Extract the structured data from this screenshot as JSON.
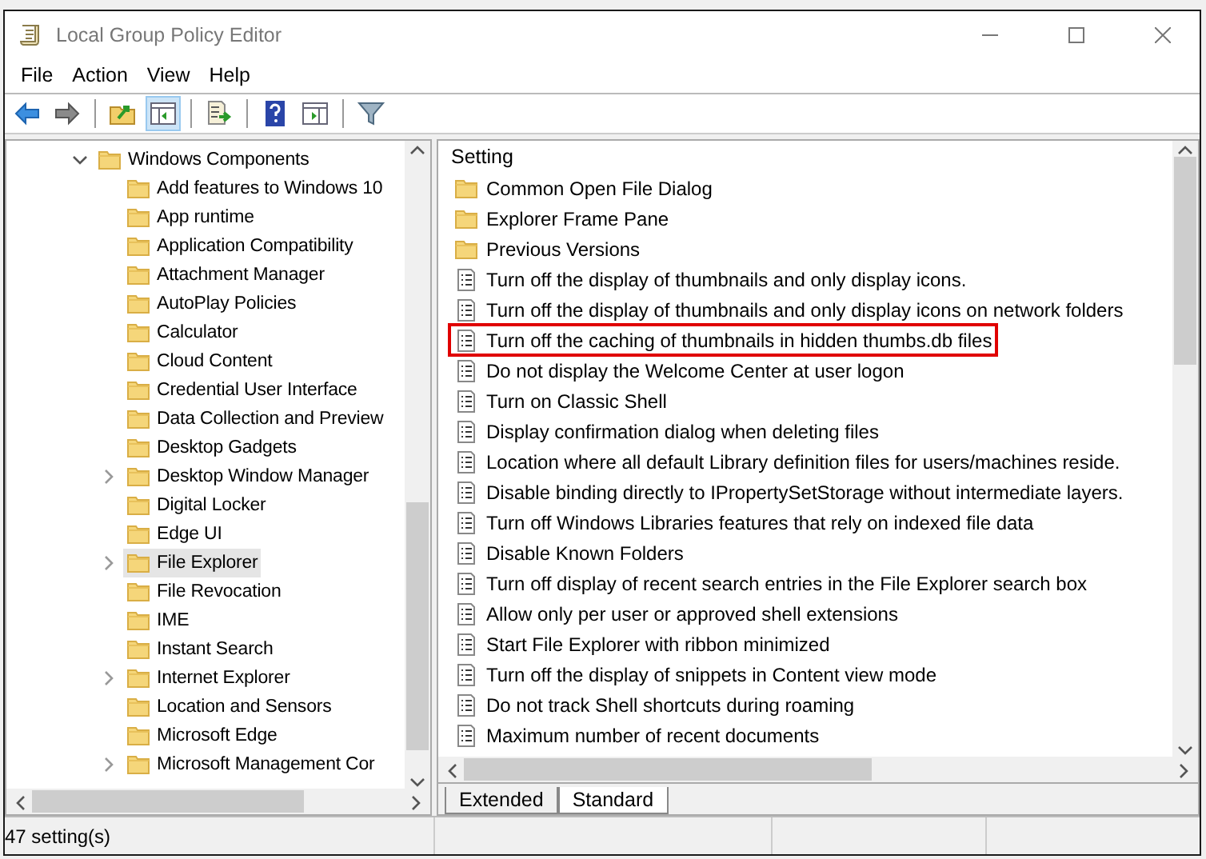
{
  "window": {
    "title": "Local Group Policy Editor"
  },
  "menu": [
    "File",
    "Action",
    "View",
    "Help"
  ],
  "toolbar": [
    {
      "kind": "back",
      "pressed": false
    },
    {
      "kind": "forward",
      "pressed": false
    },
    {
      "kind": "sep"
    },
    {
      "kind": "up",
      "pressed": false
    },
    {
      "kind": "tree",
      "pressed": true
    },
    {
      "kind": "sep"
    },
    {
      "kind": "export",
      "pressed": false
    },
    {
      "kind": "sep"
    },
    {
      "kind": "help",
      "pressed": false
    },
    {
      "kind": "pane",
      "pressed": false
    },
    {
      "kind": "sep"
    },
    {
      "kind": "filter",
      "pressed": false
    }
  ],
  "tree": [
    {
      "label": "Windows Components",
      "expanded": true,
      "children": [
        {
          "label": "Add features to Windows 10",
          "expandable": false,
          "selected": false
        },
        {
          "label": "App runtime",
          "expandable": false,
          "selected": false
        },
        {
          "label": "Application Compatibility",
          "expandable": false,
          "selected": false
        },
        {
          "label": "Attachment Manager",
          "expandable": false,
          "selected": false
        },
        {
          "label": "AutoPlay Policies",
          "expandable": false,
          "selected": false
        },
        {
          "label": "Calculator",
          "expandable": false,
          "selected": false
        },
        {
          "label": "Cloud Content",
          "expandable": false,
          "selected": false
        },
        {
          "label": "Credential User Interface",
          "expandable": false,
          "selected": false
        },
        {
          "label": "Data Collection and Preview",
          "expandable": false,
          "selected": false
        },
        {
          "label": "Desktop Gadgets",
          "expandable": false,
          "selected": false
        },
        {
          "label": "Desktop Window Manager",
          "expandable": true,
          "selected": false
        },
        {
          "label": "Digital Locker",
          "expandable": false,
          "selected": false
        },
        {
          "label": "Edge UI",
          "expandable": false,
          "selected": false
        },
        {
          "label": "File Explorer",
          "expandable": true,
          "selected": true
        },
        {
          "label": "File Revocation",
          "expandable": false,
          "selected": false
        },
        {
          "label": "IME",
          "expandable": false,
          "selected": false
        },
        {
          "label": "Instant Search",
          "expandable": false,
          "selected": false
        },
        {
          "label": "Internet Explorer",
          "expandable": true,
          "selected": false
        },
        {
          "label": "Location and Sensors",
          "expandable": false,
          "selected": false
        },
        {
          "label": "Microsoft Edge",
          "expandable": false,
          "selected": false
        },
        {
          "label": "Microsoft Management Cor",
          "expandable": true,
          "selected": false
        }
      ]
    }
  ],
  "list": {
    "column": "Setting",
    "rows": [
      {
        "kind": "folder",
        "label": "Common Open File Dialog",
        "marked": false
      },
      {
        "kind": "folder",
        "label": "Explorer Frame Pane",
        "marked": false
      },
      {
        "kind": "folder",
        "label": "Previous Versions",
        "marked": false
      },
      {
        "kind": "setting",
        "label": "Turn off the display of thumbnails and only display icons.",
        "marked": false
      },
      {
        "kind": "setting",
        "label": "Turn off the display of thumbnails and only display icons on network folders",
        "marked": false
      },
      {
        "kind": "setting",
        "label": "Turn off the caching of thumbnails in hidden thumbs.db files",
        "marked": true
      },
      {
        "kind": "setting",
        "label": "Do not display the Welcome Center at user logon",
        "marked": false
      },
      {
        "kind": "setting",
        "label": "Turn on Classic Shell",
        "marked": false
      },
      {
        "kind": "setting",
        "label": "Display confirmation dialog when deleting files",
        "marked": false
      },
      {
        "kind": "setting",
        "label": "Location where all default Library definition files for users/machines reside.",
        "marked": false
      },
      {
        "kind": "setting",
        "label": "Disable binding directly to IPropertySetStorage without intermediate layers.",
        "marked": false
      },
      {
        "kind": "setting",
        "label": "Turn off Windows Libraries features that rely on indexed file data",
        "marked": false
      },
      {
        "kind": "setting",
        "label": "Disable Known Folders",
        "marked": false
      },
      {
        "kind": "setting",
        "label": "Turn off display of recent search entries in the File Explorer search box",
        "marked": false
      },
      {
        "kind": "setting",
        "label": "Allow only per user or approved shell extensions",
        "marked": false
      },
      {
        "kind": "setting",
        "label": "Start File Explorer with ribbon minimized",
        "marked": false
      },
      {
        "kind": "setting",
        "label": "Turn off the display of snippets in Content view mode",
        "marked": false
      },
      {
        "kind": "setting",
        "label": "Do not track Shell shortcuts during roaming",
        "marked": false
      },
      {
        "kind": "setting",
        "label": "Maximum number of recent documents",
        "marked": false
      }
    ]
  },
  "tabs": [
    {
      "label": "Extended",
      "selected": false
    },
    {
      "label": "Standard",
      "selected": true
    }
  ],
  "status_bar": "47 setting(s)"
}
